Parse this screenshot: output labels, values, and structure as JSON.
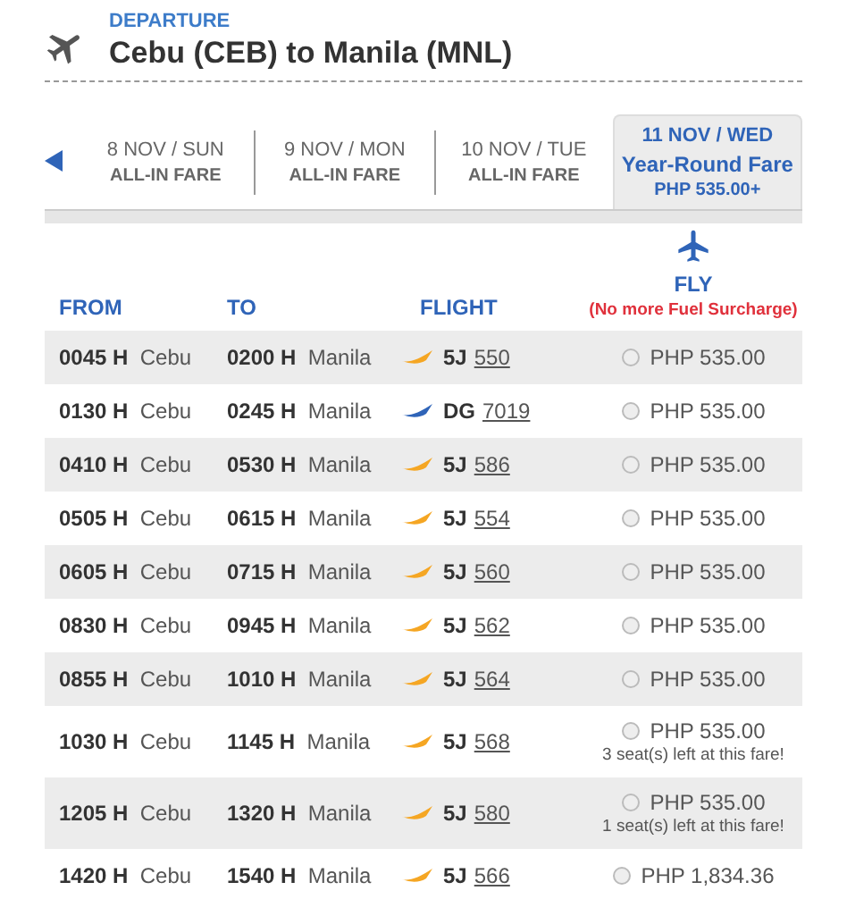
{
  "header": {
    "label": "DEPARTURE",
    "title": "Cebu (CEB) to Manila (MNL)"
  },
  "tabs": [
    {
      "date": "8 NOV / SUN",
      "fare": "ALL-IN FARE",
      "selected": false
    },
    {
      "date": "9 NOV / MON",
      "fare": "ALL-IN FARE",
      "selected": false
    },
    {
      "date": "10 NOV / TUE",
      "fare": "ALL-IN FARE",
      "selected": false
    },
    {
      "date": "11 NOV / WED",
      "fare": "Year-Round Fare",
      "price": "PHP 535.00+",
      "selected": true
    }
  ],
  "table": {
    "columns": [
      "FROM",
      "TO",
      "FLIGHT"
    ],
    "fare_column": {
      "label": "FLY",
      "note": "(No more Fuel Surcharge)"
    },
    "rows": [
      {
        "from_time": "0045 H",
        "from_city": "Cebu",
        "to_time": "0200 H",
        "to_city": "Manila",
        "carrier": "5J",
        "flight": "550",
        "color": "#f5a623",
        "price": "PHP 535.00",
        "selected": false
      },
      {
        "from_time": "0130 H",
        "from_city": "Cebu",
        "to_time": "0245 H",
        "to_city": "Manila",
        "carrier": "DG",
        "flight": "7019",
        "color": "#2f64b8",
        "price": "PHP 535.00",
        "selected": false
      },
      {
        "from_time": "0410 H",
        "from_city": "Cebu",
        "to_time": "0530 H",
        "to_city": "Manila",
        "carrier": "5J",
        "flight": "586",
        "color": "#f5a623",
        "price": "PHP 535.00",
        "selected": false
      },
      {
        "from_time": "0505 H",
        "from_city": "Cebu",
        "to_time": "0615 H",
        "to_city": "Manila",
        "carrier": "5J",
        "flight": "554",
        "color": "#f5a623",
        "price": "PHP 535.00",
        "selected": false
      },
      {
        "from_time": "0605 H",
        "from_city": "Cebu",
        "to_time": "0715 H",
        "to_city": "Manila",
        "carrier": "5J",
        "flight": "560",
        "color": "#f5a623",
        "price": "PHP 535.00",
        "selected": false
      },
      {
        "from_time": "0830 H",
        "from_city": "Cebu",
        "to_time": "0945 H",
        "to_city": "Manila",
        "carrier": "5J",
        "flight": "562",
        "color": "#f5a623",
        "price": "PHP 535.00",
        "selected": false
      },
      {
        "from_time": "0855 H",
        "from_city": "Cebu",
        "to_time": "1010 H",
        "to_city": "Manila",
        "carrier": "5J",
        "flight": "564",
        "color": "#f5a623",
        "price": "PHP 535.00",
        "selected": false
      },
      {
        "from_time": "1030 H",
        "from_city": "Cebu",
        "to_time": "1145 H",
        "to_city": "Manila",
        "carrier": "5J",
        "flight": "568",
        "color": "#f5a623",
        "price": "PHP 535.00",
        "seats_note": "3 seat(s) left at this fare!",
        "selected": false
      },
      {
        "from_time": "1205 H",
        "from_city": "Cebu",
        "to_time": "1320 H",
        "to_city": "Manila",
        "carrier": "5J",
        "flight": "580",
        "color": "#f5a623",
        "price": "PHP 535.00",
        "seats_note": "1 seat(s) left at this fare!",
        "selected": false
      },
      {
        "from_time": "1420 H",
        "from_city": "Cebu",
        "to_time": "1540 H",
        "to_city": "Manila",
        "carrier": "5J",
        "flight": "566",
        "color": "#f5a623",
        "price": "PHP 1,834.36",
        "selected": false
      }
    ]
  }
}
